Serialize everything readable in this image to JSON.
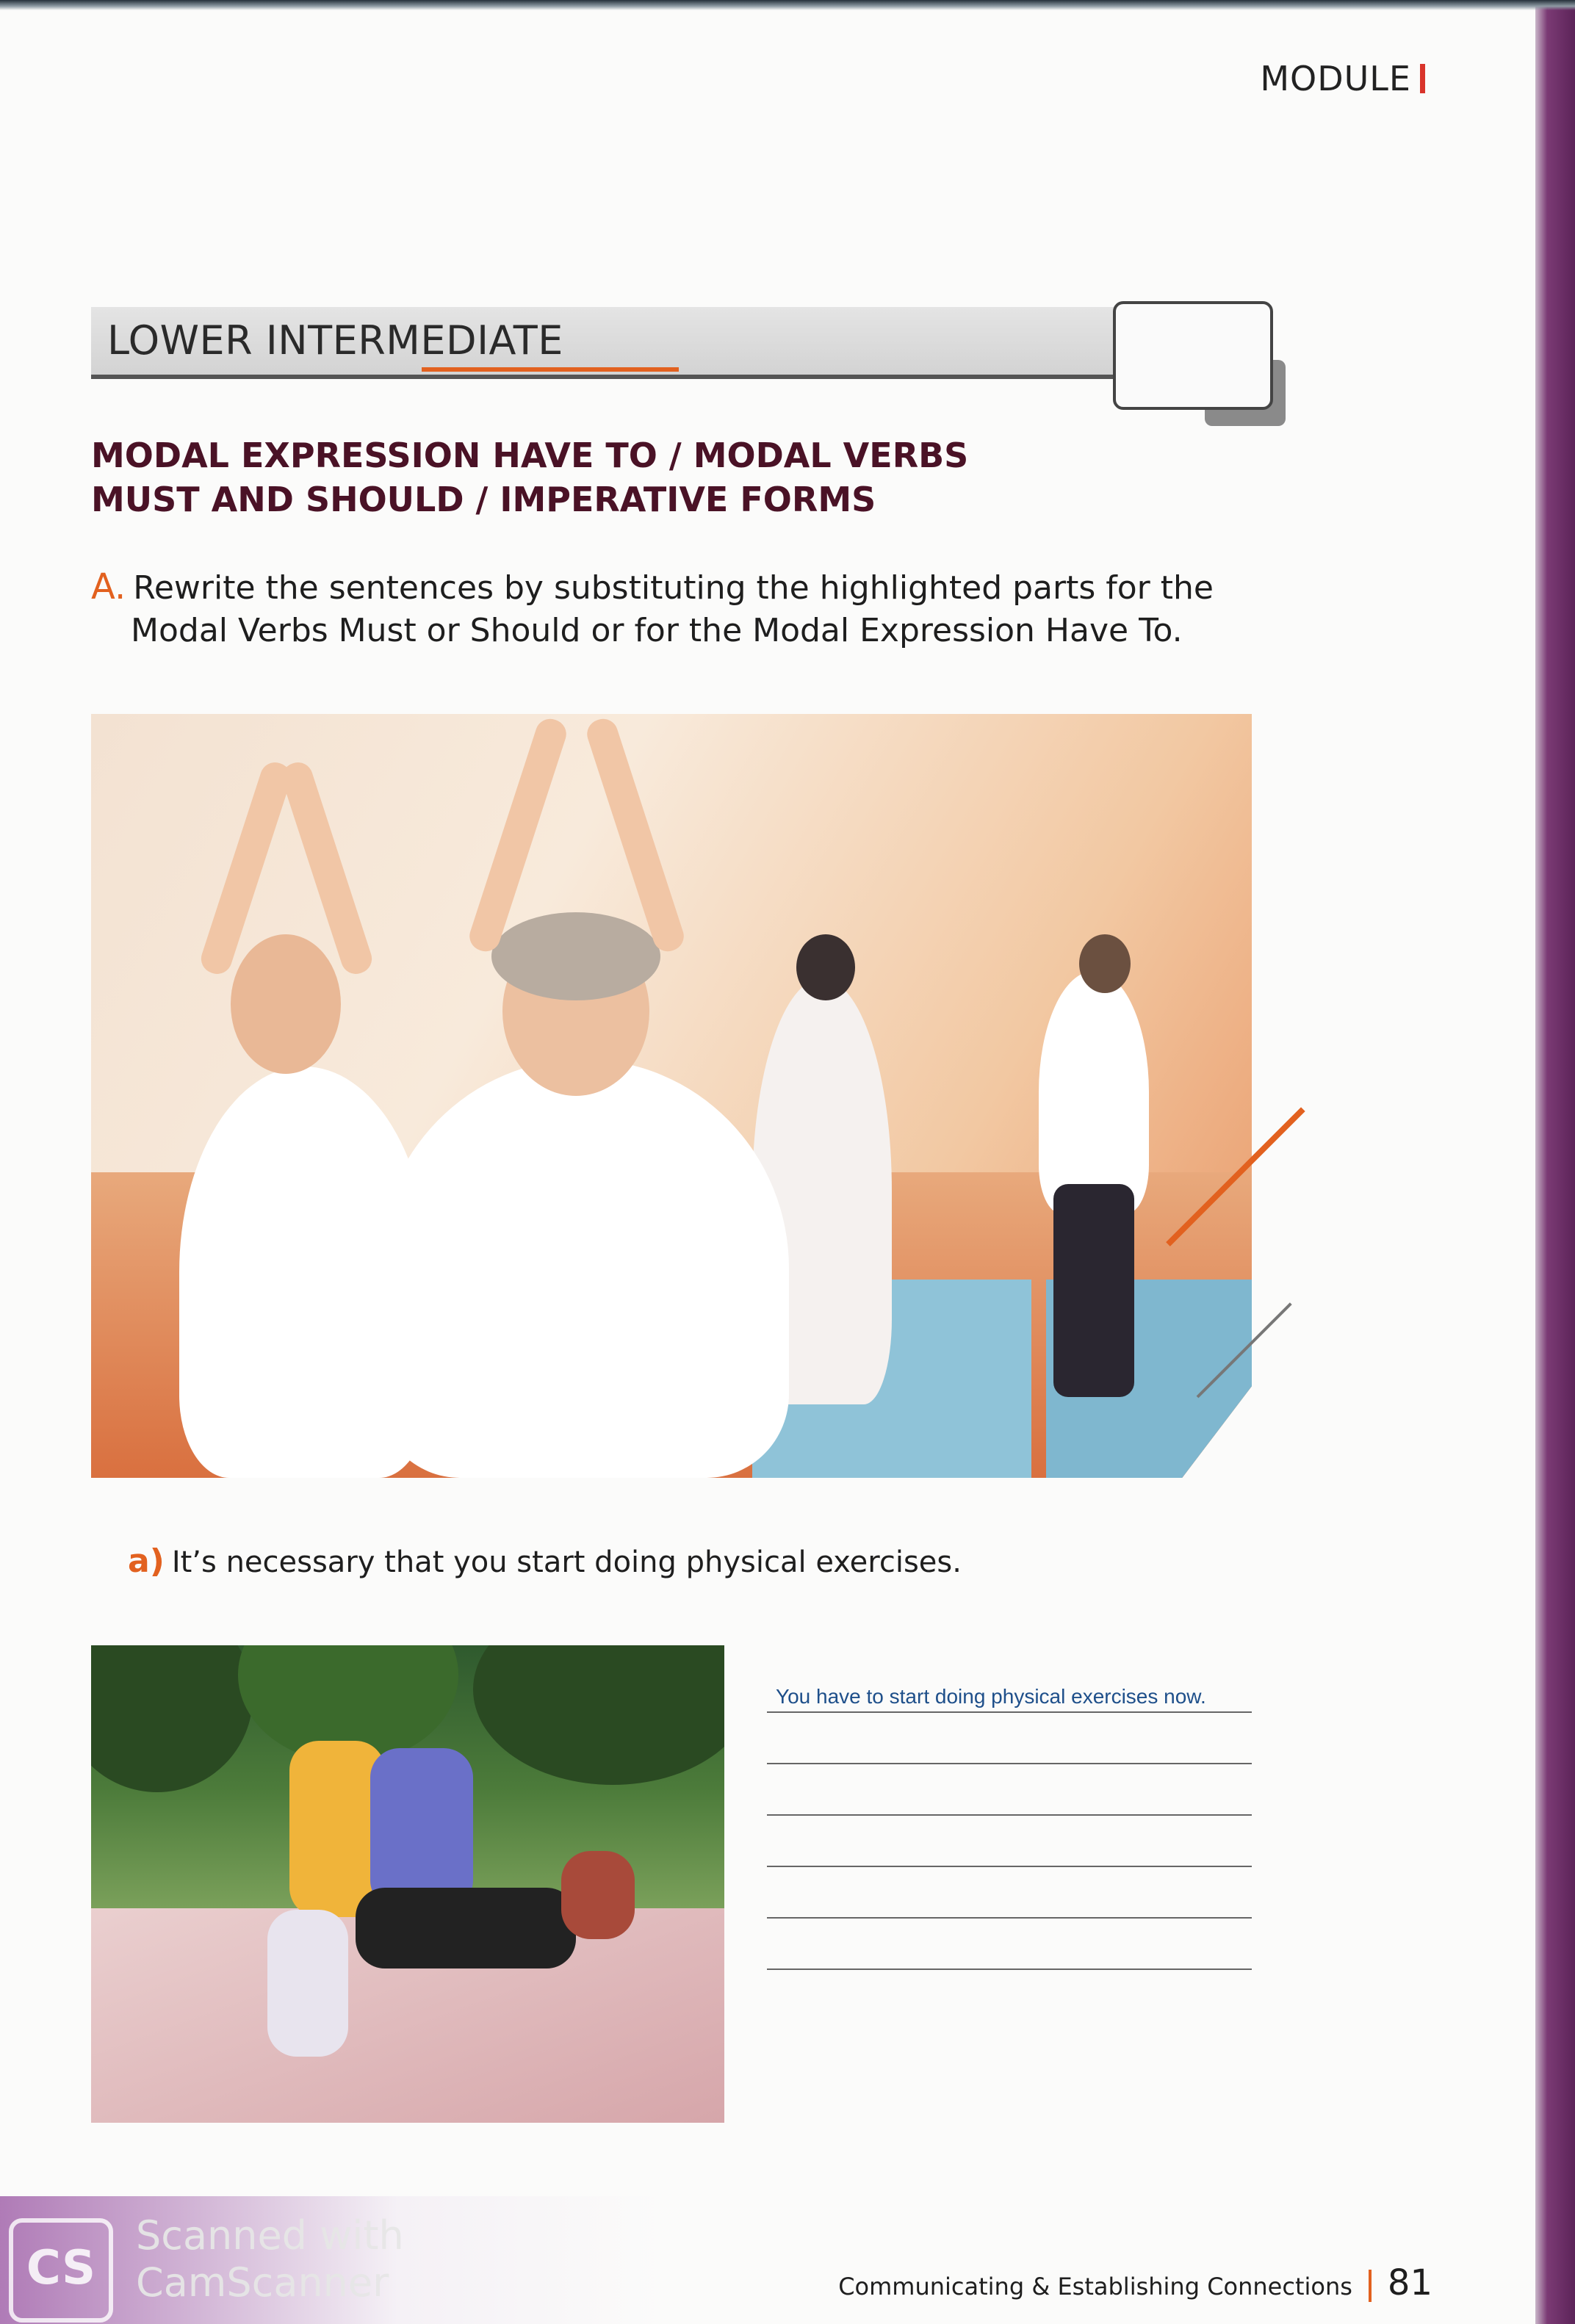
{
  "header": {
    "module_label": "MODULE"
  },
  "banner": {
    "level_label": "LOWER INTERMEDIATE"
  },
  "section": {
    "title_line1": "MODAL EXPRESSION HAVE TO / MODAL VERBS",
    "title_line2": "MUST AND SHOULD / IMPERATIVE FORMS"
  },
  "instruction": {
    "letter": "A.",
    "line1": "Rewrite the sentences by substituting the highlighted parts for the",
    "line2": "Modal Verbs Must or Should or for the Modal Expression Have To."
  },
  "exercise": {
    "item_letter": "a)",
    "sentence": "It’s necessary that you start doing physical exercises.",
    "answer": "You have to start doing physical exercises now."
  },
  "footer": {
    "chapter": "Communicating & Establishing Connections",
    "page_number": "81"
  },
  "watermark": {
    "logo_text": "CS",
    "line1": "Scanned with",
    "line2": "CamScanner"
  },
  "colors": {
    "accent_orange": "#e2611f",
    "heading_maroon": "#4a1226",
    "answer_blue": "#1e4f8a"
  }
}
